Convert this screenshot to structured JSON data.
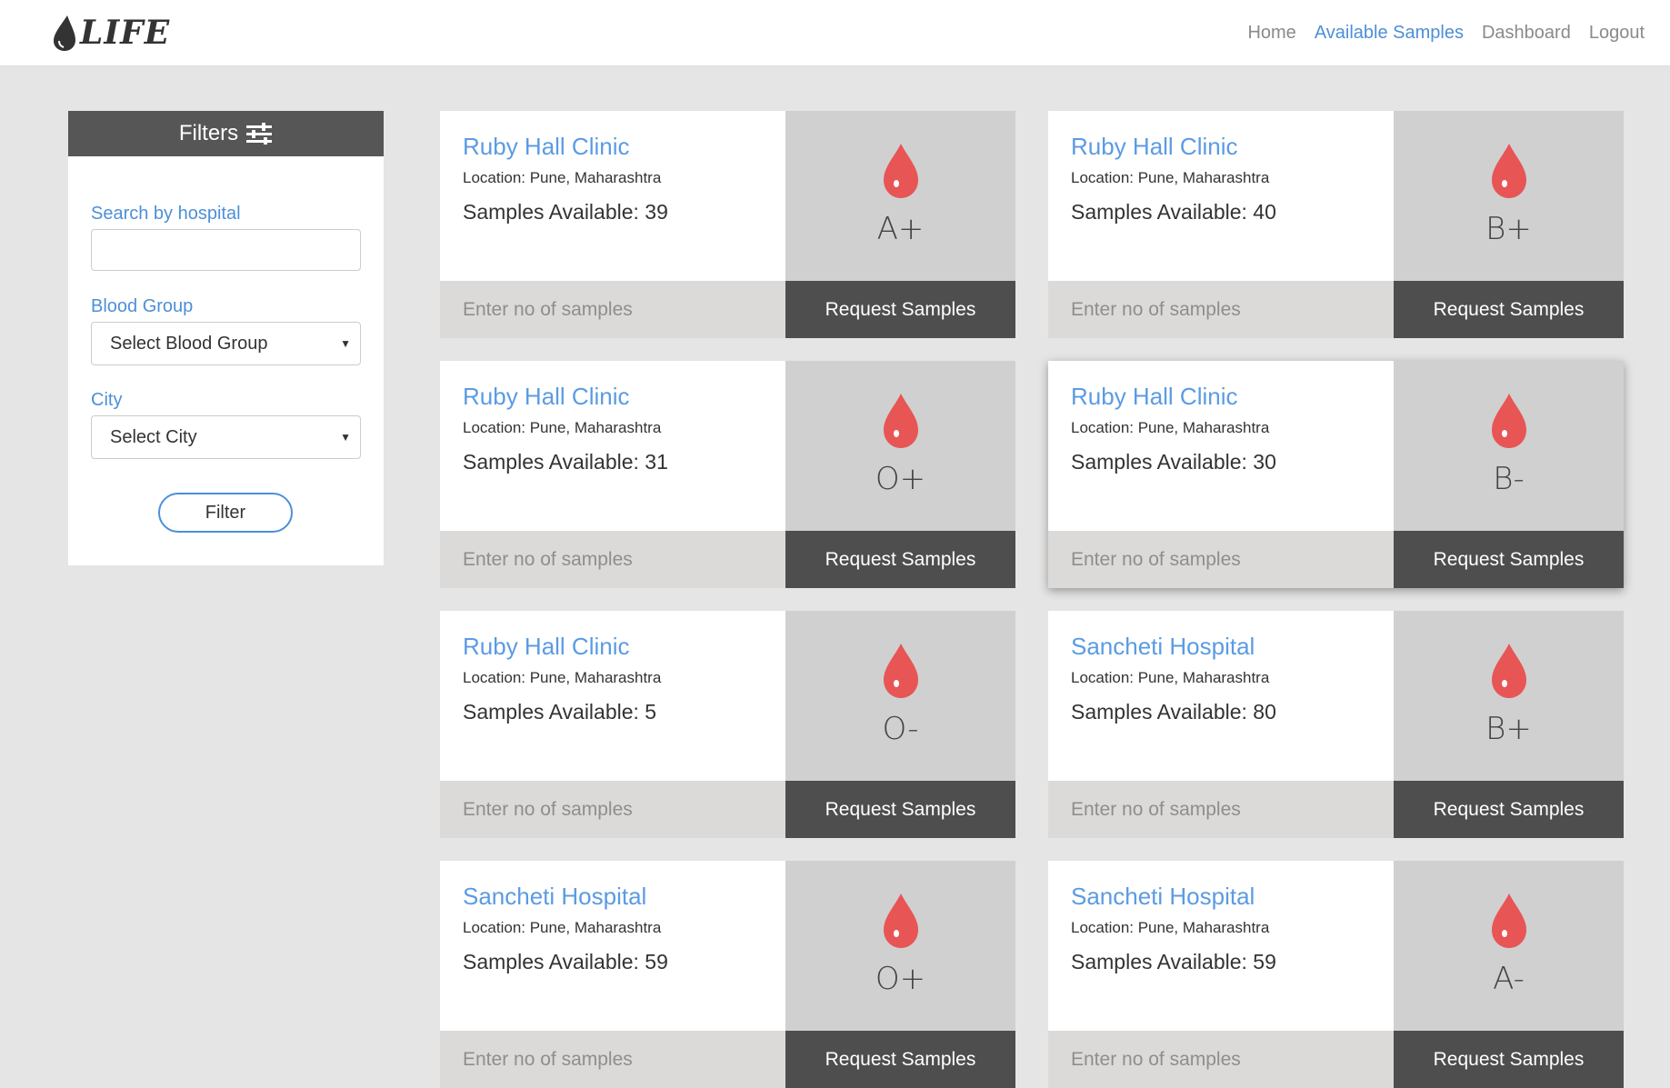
{
  "brand": {
    "logo_text": "LIFE"
  },
  "nav": {
    "links": [
      {
        "label": "Home",
        "active": false
      },
      {
        "label": "Available Samples",
        "active": true
      },
      {
        "label": "Dashboard",
        "active": false
      },
      {
        "label": "Logout",
        "active": false
      }
    ]
  },
  "filters": {
    "title": "Filters",
    "search_label": "Search by hospital",
    "search_value": "",
    "blood_group_label": "Blood Group",
    "blood_group_selected": "Select Blood Group",
    "city_label": "City",
    "city_selected": "Select City",
    "filter_button": "Filter"
  },
  "cards": [
    {
      "hospital": "Ruby Hall Clinic",
      "location": "Location: Pune, Maharashtra",
      "samples": "Samples Available: 39",
      "blood_group": "A+",
      "qty_placeholder": "Enter no of samples",
      "request_label": "Request Samples"
    },
    {
      "hospital": "Ruby Hall Clinic",
      "location": "Location: Pune, Maharashtra",
      "samples": "Samples Available: 40",
      "blood_group": "B+",
      "qty_placeholder": "Enter no of samples",
      "request_label": "Request Samples"
    },
    {
      "hospital": "Ruby Hall Clinic",
      "location": "Location: Pune, Maharashtra",
      "samples": "Samples Available: 31",
      "blood_group": "O+",
      "qty_placeholder": "Enter no of samples",
      "request_label": "Request Samples"
    },
    {
      "hospital": "Ruby Hall Clinic",
      "location": "Location: Pune, Maharashtra",
      "samples": "Samples Available: 30",
      "blood_group": "B-",
      "qty_placeholder": "Enter no of samples",
      "request_label": "Request Samples"
    },
    {
      "hospital": "Ruby Hall Clinic",
      "location": "Location: Pune, Maharashtra",
      "samples": "Samples Available: 5",
      "blood_group": "O-",
      "qty_placeholder": "Enter no of samples",
      "request_label": "Request Samples"
    },
    {
      "hospital": "Sancheti Hospital",
      "location": "Location: Pune, Maharashtra",
      "samples": "Samples Available: 80",
      "blood_group": "B+",
      "qty_placeholder": "Enter no of samples",
      "request_label": "Request Samples"
    },
    {
      "hospital": "Sancheti Hospital",
      "location": "Location: Pune, Maharashtra",
      "samples": "Samples Available: 59",
      "blood_group": "O+",
      "qty_placeholder": "Enter no of samples",
      "request_label": "Request Samples"
    },
    {
      "hospital": "Sancheti Hospital",
      "location": "Location: Pune, Maharashtra",
      "samples": "Samples Available: 59",
      "blood_group": "A-",
      "qty_placeholder": "Enter no of samples",
      "request_label": "Request Samples"
    }
  ],
  "icons": {
    "logo": "blood-drop-icon",
    "filters": "sliders-icon",
    "card": "blood-drop-icon",
    "select": "caret-down-icon"
  },
  "colors": {
    "accent": "#4d8fd8",
    "hospital_link": "#5b9be3",
    "drop": "#e85555",
    "header_dark": "#565656",
    "request_button": "#4e4e4e"
  }
}
